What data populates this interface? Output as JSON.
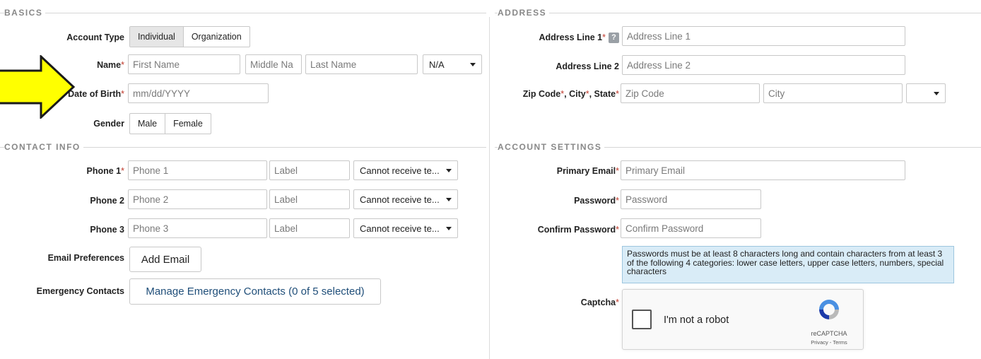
{
  "sections": {
    "basics": "BASICS",
    "address": "ADDRESS",
    "contact": "CONTACT INFO",
    "account": "ACCOUNT SETTINGS"
  },
  "basics": {
    "account_type_label": "Account Type",
    "account_type_options": [
      "Individual",
      "Organization"
    ],
    "account_type_selected": "Individual",
    "name_label": "Name",
    "first_name_placeholder": "First Name",
    "middle_name_placeholder": "Middle Na",
    "last_name_placeholder": "Last Name",
    "suffix_value": "N/A",
    "dob_label": "Date of Birth",
    "dob_placeholder": "mm/dd/YYYY",
    "gender_label": "Gender",
    "gender_options": [
      "Male",
      "Female"
    ],
    "required_mark": "*"
  },
  "address": {
    "line1_label": "Address Line 1",
    "line1_help": "?",
    "line1_placeholder": "Address Line 1",
    "line2_label": "Address Line 2",
    "line2_placeholder": "Address Line 2",
    "zip_label": "Zip Code",
    "city_label": "City",
    "state_label": "State",
    "zip_placeholder": "Zip Code",
    "city_placeholder": "City",
    "state_value": ""
  },
  "contact": {
    "phones": [
      {
        "label": "Phone 1",
        "required": true,
        "placeholder": "Phone 1",
        "label_placeholder": "Label",
        "sms": "Cannot receive te..."
      },
      {
        "label": "Phone 2",
        "required": false,
        "placeholder": "Phone 2",
        "label_placeholder": "Label",
        "sms": "Cannot receive te..."
      },
      {
        "label": "Phone 3",
        "required": false,
        "placeholder": "Phone 3",
        "label_placeholder": "Label",
        "sms": "Cannot receive te..."
      }
    ],
    "email_pref_label": "Email Preferences",
    "add_email_button": "Add Email",
    "emergency_label": "Emergency Contacts",
    "emergency_button": "Manage Emergency Contacts (0 of 5 selected)"
  },
  "account": {
    "email_label": "Primary Email",
    "email_placeholder": "Primary Email",
    "password_label": "Password",
    "password_placeholder": "Password",
    "confirm_label": "Confirm Password",
    "confirm_placeholder": "Confirm Password",
    "password_notice": "Passwords must be at least 8 characters long and contain characters from at least 3 of the following 4 categories: lower case letters, upper case letters, numbers, special characters",
    "captcha_label": "Captcha",
    "captcha_text": "I'm not a robot",
    "captcha_brand": "reCAPTCHA",
    "captcha_links": "Privacy - Terms"
  },
  "colors": {
    "required": "#c0392b",
    "arrow_fill": "#ffff00",
    "notice_bg": "#d9ecf7",
    "link_blue": "#1f4e79"
  },
  "icons": {
    "pointer_arrow": "pointer-arrow-icon",
    "help": "help-icon",
    "caret": "chevron-down-icon",
    "recaptcha": "recaptcha-logo-icon"
  }
}
